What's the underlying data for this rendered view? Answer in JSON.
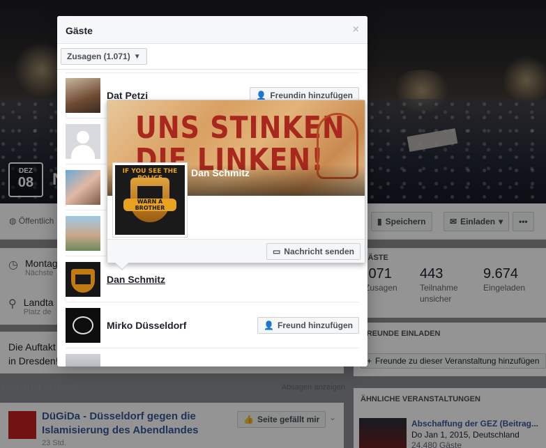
{
  "event": {
    "date_month": "DEZ",
    "date_day": "08",
    "title_partial": "N",
    "public_label": "Öffentlich",
    "save_label": "Speichern",
    "invite_label": "Einladen",
    "more_label": "•••",
    "time_main": "Montag",
    "time_sub": "Nächste",
    "place_main": "Landta",
    "place_sub": "Platz de",
    "description_line1": "Die Auftakt",
    "description_line2": "in Dresden!"
  },
  "stats": {
    "section_label": "Gäste",
    "items": [
      {
        "number": ".071",
        "label": "Zusagen"
      },
      {
        "number": "443",
        "label": "Teilnahme unsicher"
      },
      {
        "number": "9.674",
        "label": "Eingeladen"
      }
    ]
  },
  "invite": {
    "section_label": "Freunde einladen",
    "button_label": "Freunde zu dieser Veranstaltung hinzufügen"
  },
  "pinned": {
    "section_label": "Fixierter Beitrag",
    "cancel_link": "Absagen anzeigen",
    "post_title": "DüGiDa - Düsseldorf gegen die Islamisierung des Abendlandes",
    "post_meta": "23 Std.",
    "like_button": "Seite gefällt mir"
  },
  "similar": {
    "section_label": "Ähnliche Veranstaltungen",
    "title": "Abschaffung der GEZ (Beitrag...",
    "date_place": "Do Jan 1, 2015, Deutschland",
    "guests": "24.480 Gäste"
  },
  "dialog": {
    "title": "Gäste",
    "close_label": "×",
    "filter_label": "Zusagen (1.071)",
    "guests": [
      {
        "name": "Dat Petzi",
        "button": "Freundin hinzufügen"
      },
      {
        "name": "",
        "button": ""
      },
      {
        "name": "",
        "button": ""
      },
      {
        "name": "",
        "button": ""
      },
      {
        "name": "Dan Schmitz",
        "button": ""
      },
      {
        "name": "Mirko Düsseldorf",
        "button": "Freund hinzufügen"
      }
    ]
  },
  "hovercard": {
    "cover_slogan_line1": "UNS STINKEN",
    "cover_slogan_line2": "DIE LINKEN!",
    "name": "Dan Schmitz",
    "message_button": "Nachricht senden",
    "profile_text_top": "IF YOU SEE THE POLICE",
    "profile_text_bottom": "WARN A BROTHER"
  }
}
